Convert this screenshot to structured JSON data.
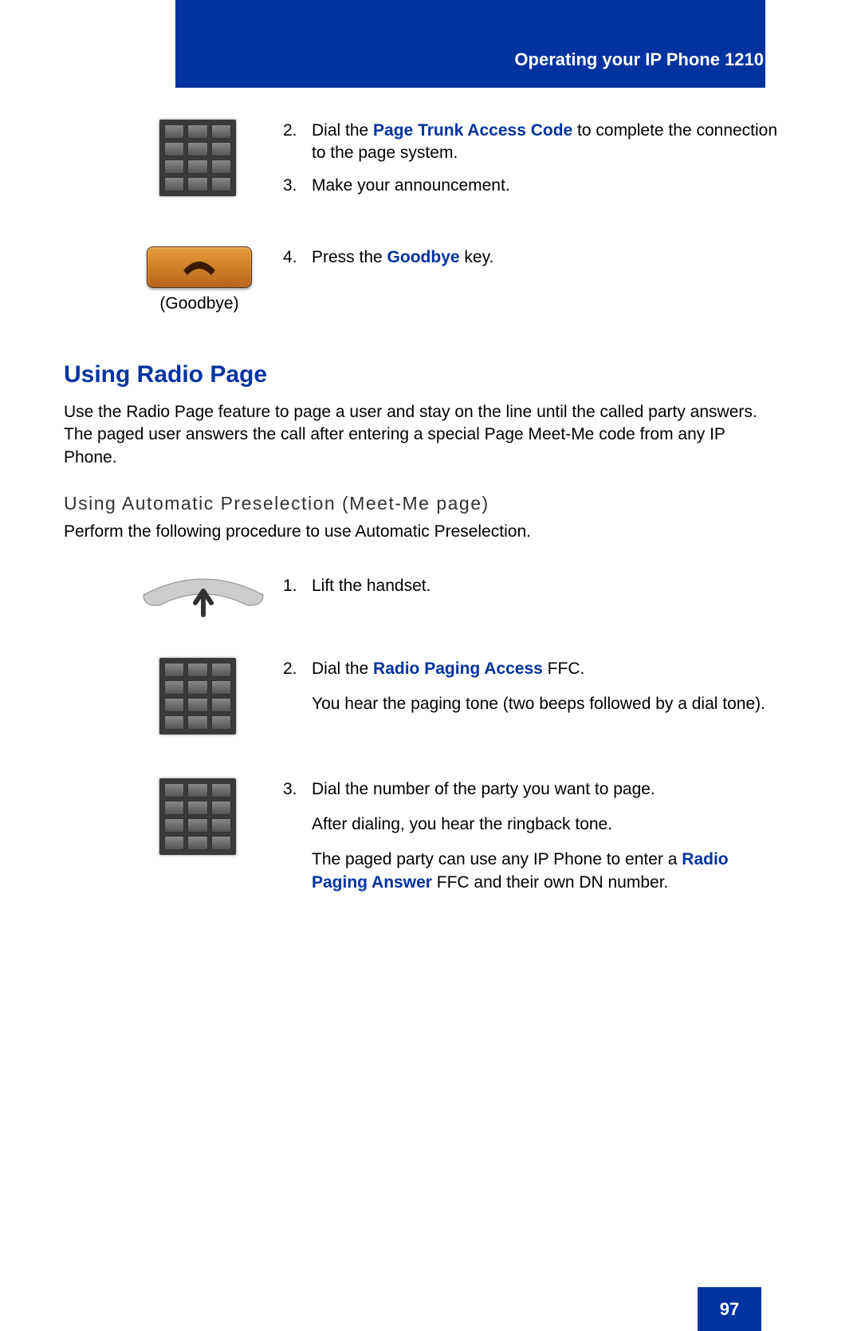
{
  "header": {
    "title": "Operating your IP Phone 1210"
  },
  "topSteps": {
    "s2": {
      "num": "2.",
      "pre": "Dial the ",
      "link": "Page Trunk Access Code",
      "post": " to complete the connection to the page system."
    },
    "s3": {
      "num": "3.",
      "text": "Make your announcement."
    },
    "s4": {
      "num": "4.",
      "pre": "Press the ",
      "link": "Goodbye",
      "post": " key."
    },
    "goodbyeLabel": "(Goodbye)"
  },
  "radio": {
    "heading": "Using Radio Page",
    "intro": "Use the Radio Page feature to page a user and stay on the line until the called party answers. The paged user answers the call after entering a special Page Meet-Me code from any IP Phone.",
    "subheading": "Using Automatic Preselection (Meet-Me page)",
    "subintro": "Perform the following procedure to use Automatic Preselection.",
    "s1": {
      "num": "1.",
      "text": "Lift the handset."
    },
    "s2": {
      "num": "2.",
      "pre": "Dial the ",
      "link": "Radio Paging Access",
      "post": " FFC.",
      "p2": "You hear the paging tone (two beeps followed by a dial tone)."
    },
    "s3": {
      "num": "3.",
      "p1": "Dial the number of the party you want to page.",
      "p2": "After dialing, you hear the ringback tone.",
      "p3a": "The paged party can use any IP Phone to enter a ",
      "p3link": "Radio Paging Answer",
      "p3b": " FFC and their own DN number."
    }
  },
  "pageNumber": "97"
}
